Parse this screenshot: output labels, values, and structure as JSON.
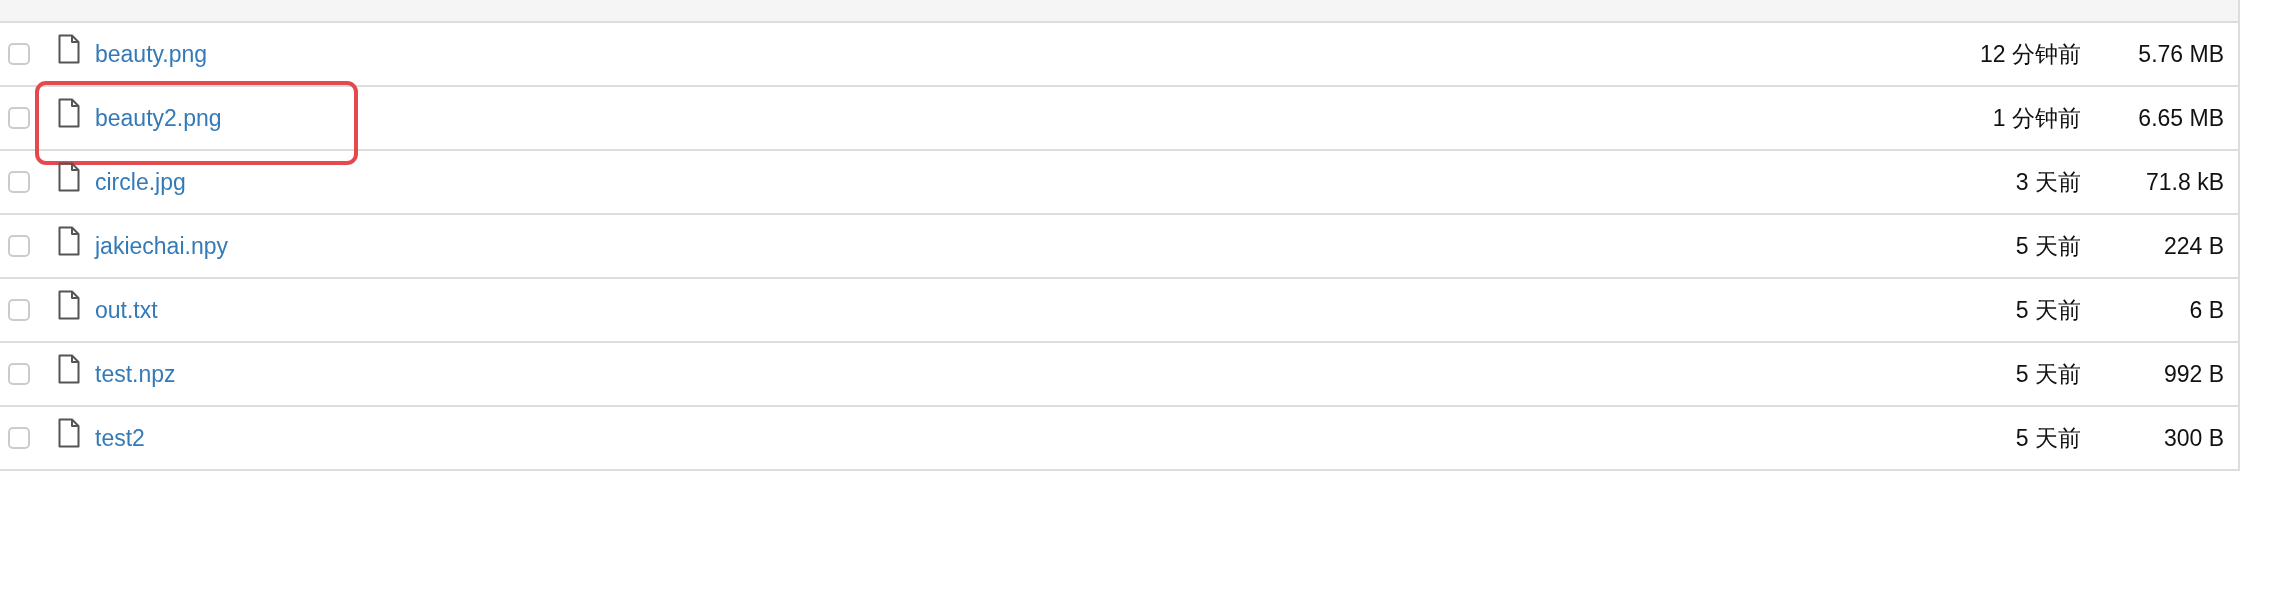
{
  "files": [
    {
      "name": "beauty.png",
      "modified": "12 分钟前",
      "size": "5.76 MB",
      "checked": false,
      "annotated": false
    },
    {
      "name": "beauty2.png",
      "modified": "1 分钟前",
      "size": "6.65 MB",
      "checked": false,
      "annotated": true
    },
    {
      "name": "circle.jpg",
      "modified": "3 天前",
      "size": "71.8 kB",
      "checked": false,
      "annotated": false
    },
    {
      "name": "jakiechai.npy",
      "modified": "5 天前",
      "size": "224 B",
      "checked": false,
      "annotated": false
    },
    {
      "name": "out.txt",
      "modified": "5 天前",
      "size": "6 B",
      "checked": false,
      "annotated": false
    },
    {
      "name": "test.npz",
      "modified": "5 天前",
      "size": "992 B",
      "checked": false,
      "annotated": false
    },
    {
      "name": "test2",
      "modified": "5 天前",
      "size": "300 B",
      "checked": false,
      "annotated": false
    }
  ]
}
